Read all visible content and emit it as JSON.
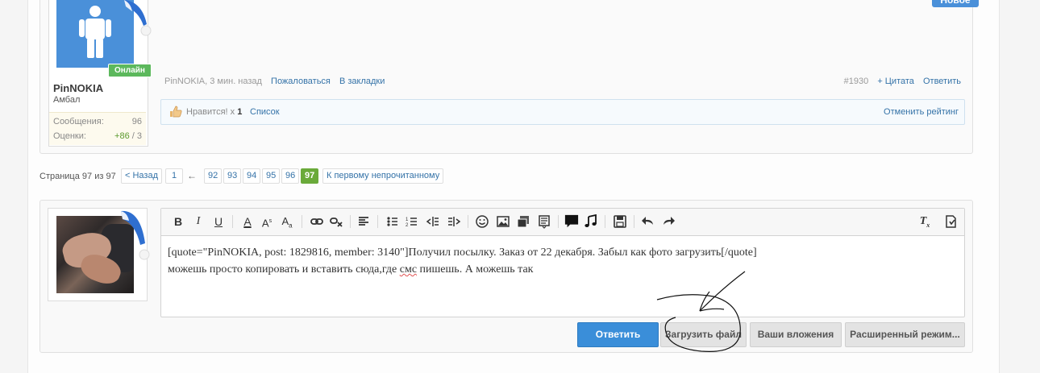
{
  "new_badge": "Новое",
  "post": {
    "username": "PinNOKIA",
    "user_title": "Амбал",
    "online_label": "Онлайн",
    "stats": {
      "messages_label": "Сообщения:",
      "messages_value": "96",
      "ratings_label": "Оценки:",
      "ratings_positive": "+86",
      "ratings_rest": " / 3"
    },
    "meta": {
      "author_time": "PinNOKIA, 3 мин. назад",
      "report": "Пожаловаться",
      "bookmark": "В закладки",
      "post_number": "#1930",
      "quote": "+ Цитата",
      "reply": "Ответить"
    },
    "likes": {
      "text": "Нравится! x",
      "count": "1",
      "list": "Список",
      "undo": "Отменить рейтинг"
    }
  },
  "pagination": {
    "label": "Страница 97 из 97",
    "prev": "< Назад",
    "first": "1",
    "ellipsis": "←",
    "pages": [
      "92",
      "93",
      "94",
      "95",
      "96",
      "97"
    ],
    "current": "97",
    "first_unread": "К первому непрочитанному"
  },
  "editor": {
    "toolbar": [
      "bold",
      "italic",
      "underline",
      "font-color",
      "font-size",
      "font-family",
      "link",
      "unlink",
      "align",
      "bullet-list",
      "numbered-list",
      "outdent",
      "indent",
      "smilies",
      "image",
      "media",
      "code",
      "quote",
      "music",
      "save",
      "undo",
      "redo",
      "remove-format",
      "bbcode-toggle"
    ],
    "line1": "[quote=\"PinNOKIA, post: 1829816, member: 3140\"]Получил посылку. Заказ от 22 декабря. Забыл как фото загрузить[/quote]",
    "line2_before": "можешь просто копировать и вставить сюда,где ",
    "line2_misspelled": "смс",
    "line2_after": " пишешь. А можешь так"
  },
  "buttons": {
    "reply": "Ответить",
    "upload": "Загрузить файл",
    "attachments": "Ваши вложения",
    "advanced": "Расширенный режим..."
  },
  "colors": {
    "accent": "#3a8ed9",
    "online": "#5cb85c",
    "current_page": "#6aaa3a",
    "link": "#3573a8"
  }
}
